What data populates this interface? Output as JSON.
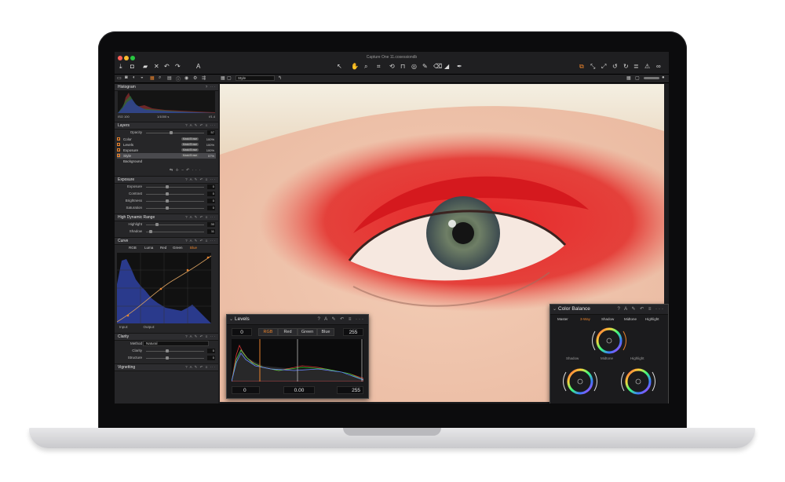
{
  "window": {
    "title": "Capture One 11.cosessiondb"
  },
  "colors": {
    "accent": "#e8822b",
    "curve_fill": "#2a3a8c"
  },
  "toolbar_icons": [
    "import-icon",
    "camera-icon",
    "folder-icon",
    "delete-icon",
    "undo-icon",
    "redo-icon",
    "text-icon",
    "cursor-icon",
    "pan-icon",
    "crop-icon",
    "rotate-icon",
    "keystone-icon",
    "spot-icon",
    "brush-icon",
    "eraser-icon",
    "gradient-icon",
    "picker-icon",
    "copy-apply-icon",
    "warning-icon",
    "glasses-icon"
  ],
  "style_select": {
    "value": "Style"
  },
  "histogram": {
    "title": "Histogram",
    "iso": "ISO 100",
    "shutter": "1/1000 s",
    "aperture": "f/1.4"
  },
  "layers": {
    "title": "Layers",
    "opacity_label": "Opacity",
    "opacity_value": "57",
    "items": [
      {
        "name": "Color",
        "mask": "Mask/Erase",
        "pct": "100%"
      },
      {
        "name": "Levels",
        "mask": "Mask/Erase",
        "pct": "100%"
      },
      {
        "name": "Exposure",
        "mask": "Mask/Erase",
        "pct": "100%"
      },
      {
        "name": "Style",
        "mask": "Mask/Erase",
        "pct": "57%"
      }
    ],
    "background": "Background"
  },
  "exposure": {
    "title": "Exposure",
    "rows": [
      {
        "label": "Exposure",
        "value": "0"
      },
      {
        "label": "Contrast",
        "value": "0"
      },
      {
        "label": "Brightness",
        "value": "0"
      },
      {
        "label": "Saturation",
        "value": "0"
      }
    ]
  },
  "hdr": {
    "title": "High Dynamic Range",
    "rows": [
      {
        "label": "Highlight",
        "value": "30"
      },
      {
        "label": "Shadow",
        "value": "11"
      }
    ]
  },
  "curve": {
    "title": "Curve",
    "tabs": [
      "RGB",
      "Luma",
      "Red",
      "Green",
      "Blue"
    ],
    "active_tab": "Blue",
    "input_label": "Input:",
    "output_label": "Output:"
  },
  "clarity": {
    "title": "Clarity",
    "method_label": "Method",
    "method_value": "Natural",
    "rows": [
      {
        "label": "Clarity",
        "value": "0"
      },
      {
        "label": "Structure",
        "value": "0"
      }
    ]
  },
  "vignetting": {
    "title": "Vignetting"
  },
  "levels": {
    "title": "Levels",
    "tabs": [
      "RGB",
      "Red",
      "Green",
      "Blue"
    ],
    "active_tab": "RGB",
    "out_low": "0",
    "out_high": "255",
    "in_low": "0",
    "mid": "0.00",
    "in_high": "255"
  },
  "color_balance": {
    "title": "Color Balance",
    "tabs": [
      "Master",
      "3-Way",
      "Shadow",
      "Midtone",
      "Highlight"
    ],
    "active_tab": "3-Way",
    "wheel_labels": {
      "shadow": "Shadow",
      "midtone": "Midtone",
      "highlight": "Highlight"
    }
  }
}
